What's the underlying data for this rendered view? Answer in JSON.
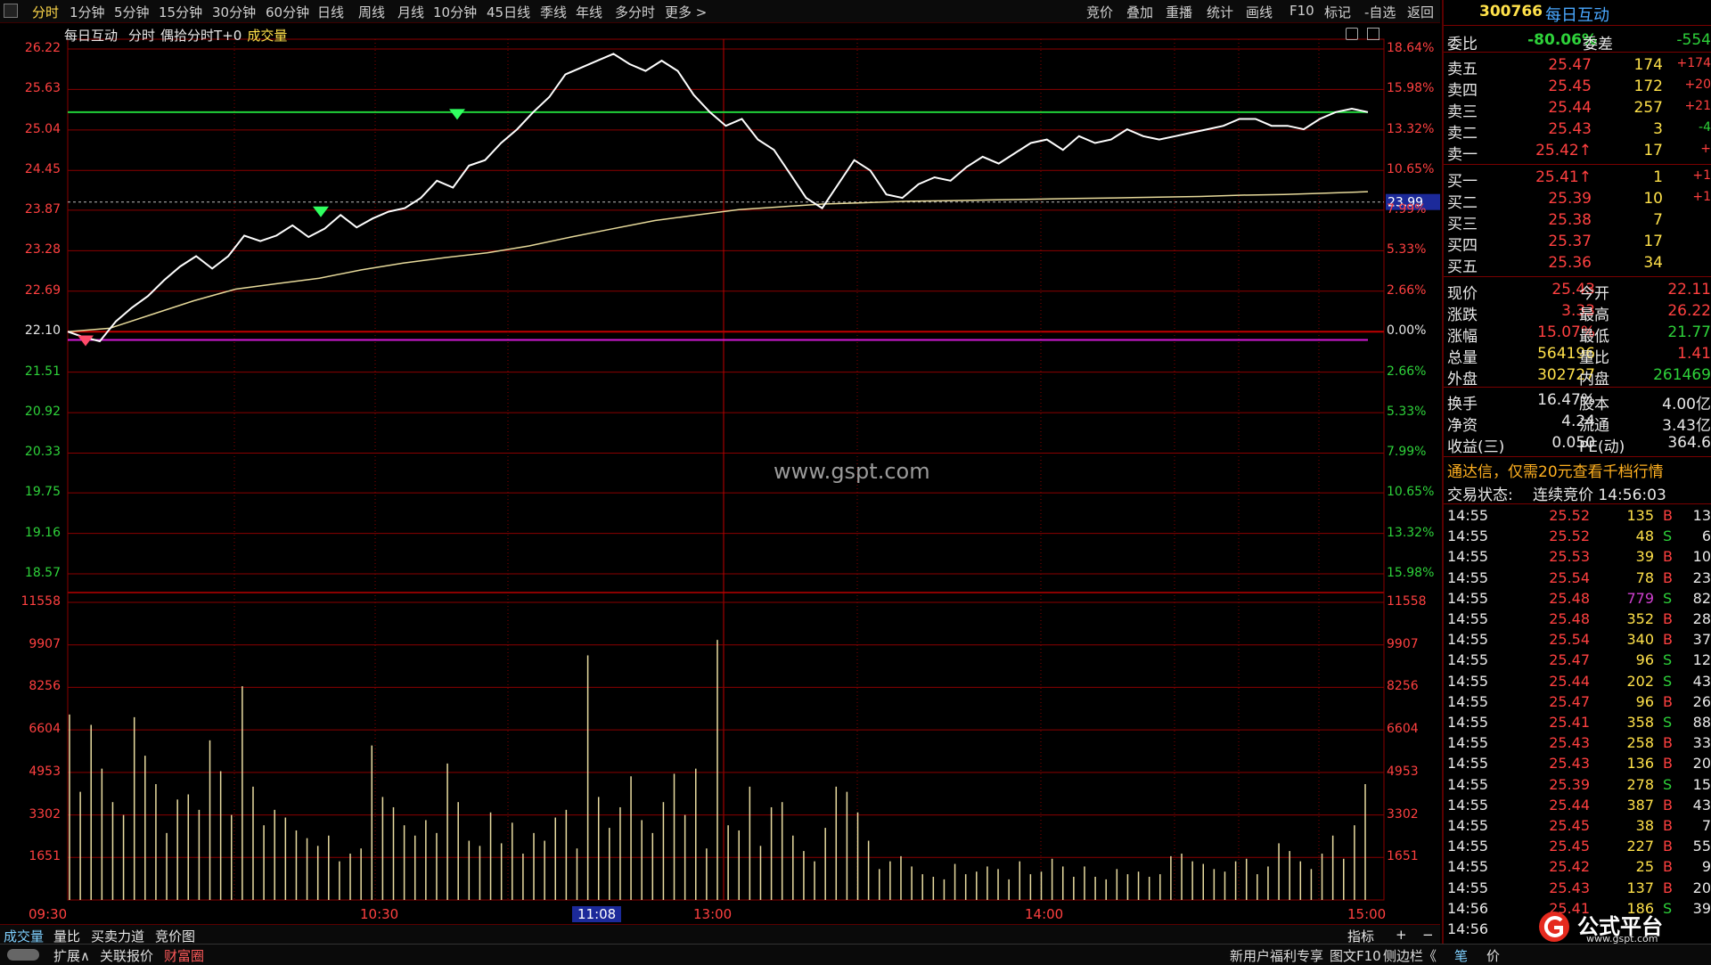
{
  "toolbar": {
    "periods": [
      "分时",
      "1分钟",
      "5分钟",
      "15分钟",
      "30分钟",
      "60分钟",
      "日线",
      "周线",
      "月线",
      "10分钟",
      "45日线",
      "季线",
      "年线",
      "多分时",
      "更多 >"
    ],
    "actions": [
      "竞价",
      "叠加",
      "重播",
      "统计",
      "画线",
      "F10",
      "标记",
      "-自选",
      "返回"
    ]
  },
  "chart_header": {
    "stock_name": "每日互动",
    "mode": "分时",
    "overlay": "偶拾分时T+0",
    "indicator": "成交量"
  },
  "price_axis": {
    "left": [
      "26.22",
      "25.63",
      "25.04",
      "24.45",
      "23.87",
      "23.28",
      "22.69",
      "22.10",
      "21.51",
      "20.92",
      "20.33",
      "19.75",
      "19.16",
      "18.57"
    ],
    "right": [
      "18.64%",
      "15.98%",
      "13.32%",
      "10.65%",
      "7.99%",
      "5.33%",
      "2.66%",
      "0.00%",
      "2.66%",
      "5.33%",
      "7.99%",
      "10.65%",
      "13.32%",
      "15.98%"
    ],
    "current_marker": "23.99"
  },
  "volume_axis": {
    "left": [
      "11558",
      "9907",
      "8256",
      "6604",
      "4953",
      "3302",
      "1651"
    ],
    "right": [
      "11558",
      "9907",
      "8256",
      "6604",
      "4953",
      "3302",
      "1651"
    ]
  },
  "time_axis": [
    "09:30",
    "10:30",
    "11:08",
    "13:00",
    "14:00",
    "15:00"
  ],
  "watermark": "www.gspt.com",
  "chart_data": {
    "type": "line",
    "title": "",
    "x": [
      "09:30",
      "15:00"
    ],
    "ylim": [
      18.57,
      26.22
    ],
    "prev_close": 22.1,
    "series": [
      {
        "values": [
          22.1,
          22.02,
          21.96,
          22.25,
          22.45,
          22.62,
          22.85,
          23.05,
          23.2,
          23.02,
          23.2,
          23.5,
          23.42,
          23.5,
          23.65,
          23.48,
          23.6,
          23.8,
          23.62,
          23.75,
          23.85,
          23.9,
          24.05,
          24.3,
          24.2,
          24.52,
          24.6,
          24.85,
          25.05,
          25.3,
          25.52,
          25.85,
          25.95,
          26.05,
          26.15,
          26.0,
          25.9,
          26.05,
          25.9,
          25.55,
          25.3,
          25.1,
          25.2,
          24.9,
          24.75,
          24.4,
          24.05,
          23.9,
          24.25,
          24.6,
          24.45,
          24.1,
          24.05,
          24.25,
          24.35,
          24.3,
          24.5,
          24.65,
          24.55,
          24.7,
          24.85,
          24.9,
          24.75,
          24.95,
          24.85,
          24.9,
          25.05,
          24.95,
          24.9,
          24.95,
          25.0,
          25.05,
          25.1,
          25.2,
          25.2,
          25.1,
          25.1,
          25.05,
          25.2,
          25.3,
          25.35,
          25.3
        ]
      },
      {
        "values": [
          22.1,
          22.15,
          22.35,
          22.55,
          22.72,
          22.8,
          22.88,
          23.0,
          23.1,
          23.18,
          23.25,
          23.35,
          23.48,
          23.6,
          23.72,
          23.8,
          23.88,
          23.92,
          23.96,
          23.98,
          24.0,
          24.01,
          24.02,
          24.03,
          24.04,
          24.05,
          24.06,
          24.07,
          24.09,
          24.1,
          24.12,
          24.14
        ]
      }
    ],
    "reference_lines": [
      25.3,
      21.98
    ],
    "volume": {
      "ylim": [
        0,
        11558
      ],
      "values": [
        7200,
        4200,
        6800,
        5100,
        3800,
        3300,
        7100,
        5600,
        4500,
        2600,
        3900,
        4100,
        3500,
        6200,
        5000,
        3300,
        8300,
        4400,
        2900,
        3500,
        3200,
        2700,
        2400,
        2100,
        2500,
        1500,
        1800,
        2000,
        6000,
        4000,
        3600,
        2900,
        2500,
        3100,
        2600,
        5300,
        3800,
        2300,
        2100,
        3400,
        2200,
        3000,
        1800,
        2600,
        2300,
        3200,
        3500,
        2000,
        9500,
        4000,
        2800,
        3600,
        4800,
        3100,
        2600,
        3800,
        4900,
        3300,
        5100,
        2000,
        10100,
        2900,
        2700,
        4400,
        2100,
        3600,
        3800,
        2500,
        1900,
        1500,
        2800,
        4400,
        4200,
        3400,
        2300,
        1200,
        1500,
        1700,
        1300,
        1000,
        900,
        800,
        1400,
        1000,
        1100,
        1300,
        1200,
        800,
        1500,
        1000,
        1100,
        1600,
        1300,
        900,
        1300,
        900,
        800,
        1200,
        1000,
        1100,
        900,
        1000,
        1700,
        1800,
        1500,
        1400,
        1200,
        1100,
        1500,
        1600,
        1000,
        1300,
        2200,
        1900,
        1500,
        1200,
        1800,
        2500,
        1600,
        2900,
        4500
      ]
    }
  },
  "depth": {
    "title_code": "300766",
    "title_name": "每日互动",
    "wei_bi_label": "委比",
    "wei_bi_value": "-80.06%",
    "wei_cha_label": "委差",
    "wei_cha_value": "-554",
    "asks": [
      {
        "label": "卖五",
        "price": "25.47",
        "vol": "174",
        "chg": "+174"
      },
      {
        "label": "卖四",
        "price": "25.45",
        "vol": "172",
        "chg": "+20"
      },
      {
        "label": "卖三",
        "price": "25.44",
        "vol": "257",
        "chg": "+21"
      },
      {
        "label": "卖二",
        "price": "25.43",
        "vol": "3",
        "chg": "-4"
      },
      {
        "label": "卖一",
        "price": "25.42↑",
        "vol": "17",
        "chg": "+"
      }
    ],
    "bids": [
      {
        "label": "买一",
        "price": "25.41↑",
        "vol": "1",
        "chg": "+1"
      },
      {
        "label": "买二",
        "price": "25.39",
        "vol": "10",
        "chg": "+1"
      },
      {
        "label": "买三",
        "price": "25.38",
        "vol": "7",
        "chg": ""
      },
      {
        "label": "买四",
        "price": "25.37",
        "vol": "17",
        "chg": ""
      },
      {
        "label": "买五",
        "price": "25.36",
        "vol": "34",
        "chg": ""
      }
    ]
  },
  "quote": [
    {
      "l1": "现价",
      "v1": "25.43",
      "l2": "今开",
      "v2": "22.11"
    },
    {
      "l1": "涨跌",
      "v1": "3.33",
      "l2": "最高",
      "v2": "26.22"
    },
    {
      "l1": "涨幅",
      "v1": "15.07%",
      "l2": "最低",
      "v2": "21.77"
    },
    {
      "l1": "总量",
      "v1": "564196",
      "l2": "量比",
      "v2": "1.41"
    },
    {
      "l1": "外盘",
      "v1": "302727",
      "l2": "内盘",
      "v2": "261469"
    }
  ],
  "finance": [
    {
      "l1": "换手",
      "v1": "16.47%",
      "l2": "股本",
      "v2": "4.00亿"
    },
    {
      "l1": "净资",
      "v1": "4.24",
      "l2": "流通",
      "v2": "3.43亿"
    },
    {
      "l1": "收益(三)",
      "v1": "0.050",
      "l2": "PE(动)",
      "v2": "364.6"
    }
  ],
  "promo": "通达信，仅需20元查看千档行情",
  "trade_status_label": "交易状态:",
  "trade_status_value": "连续竞价 14:56:03",
  "ticks": [
    {
      "t": "14:55",
      "p": "25.52",
      "v": "135",
      "s": "B",
      "n": "13"
    },
    {
      "t": "14:55",
      "p": "25.52",
      "v": "48",
      "s": "S",
      "n": "6"
    },
    {
      "t": "14:55",
      "p": "25.53",
      "v": "39",
      "s": "B",
      "n": "10"
    },
    {
      "t": "14:55",
      "p": "25.54",
      "v": "78",
      "s": "B",
      "n": "23"
    },
    {
      "t": "14:55",
      "p": "25.48",
      "v": "779",
      "s": "S",
      "n": "82"
    },
    {
      "t": "14:55",
      "p": "25.48",
      "v": "352",
      "s": "B",
      "n": "28"
    },
    {
      "t": "14:55",
      "p": "25.54",
      "v": "340",
      "s": "B",
      "n": "37"
    },
    {
      "t": "14:55",
      "p": "25.47",
      "v": "96",
      "s": "S",
      "n": "12"
    },
    {
      "t": "14:55",
      "p": "25.44",
      "v": "202",
      "s": "S",
      "n": "43"
    },
    {
      "t": "14:55",
      "p": "25.47",
      "v": "96",
      "s": "B",
      "n": "26"
    },
    {
      "t": "14:55",
      "p": "25.41",
      "v": "358",
      "s": "S",
      "n": "88"
    },
    {
      "t": "14:55",
      "p": "25.43",
      "v": "258",
      "s": "B",
      "n": "33"
    },
    {
      "t": "14:55",
      "p": "25.43",
      "v": "136",
      "s": "B",
      "n": "20"
    },
    {
      "t": "14:55",
      "p": "25.39",
      "v": "278",
      "s": "S",
      "n": "15"
    },
    {
      "t": "14:55",
      "p": "25.44",
      "v": "387",
      "s": "B",
      "n": "43"
    },
    {
      "t": "14:55",
      "p": "25.45",
      "v": "38",
      "s": "B",
      "n": "7"
    },
    {
      "t": "14:55",
      "p": "25.45",
      "v": "227",
      "s": "B",
      "n": "55"
    },
    {
      "t": "14:55",
      "p": "25.42",
      "v": "25",
      "s": "B",
      "n": "9"
    },
    {
      "t": "14:55",
      "p": "25.43",
      "v": "137",
      "s": "B",
      "n": "20"
    },
    {
      "t": "14:56",
      "p": "25.41",
      "v": "186",
      "s": "S",
      "n": "39"
    },
    {
      "t": "14:56",
      "p": "",
      "v": "",
      "s": "",
      "n": ""
    }
  ],
  "bottom_tabs": [
    "成交量",
    "量比",
    "买卖力道",
    "竞价图"
  ],
  "bottom_right_tabs": [
    "指标",
    "+",
    "−"
  ],
  "bottom_bar_left": [
    "扩展∧",
    "关联报价",
    "财富圈"
  ],
  "bottom_bar_right": [
    "新用户福利专享",
    "图文F10",
    "侧边栏《",
    "笔",
    "价"
  ],
  "logo_text": "公式平台",
  "logo_url": "www.gspt.com",
  "colors": {
    "up": "#ff4040",
    "down": "#2ed23a",
    "price_line": "#ffffff",
    "avg_line": "#e6d99a",
    "grid": "#8a0000",
    "accent": "#ffe14a"
  }
}
